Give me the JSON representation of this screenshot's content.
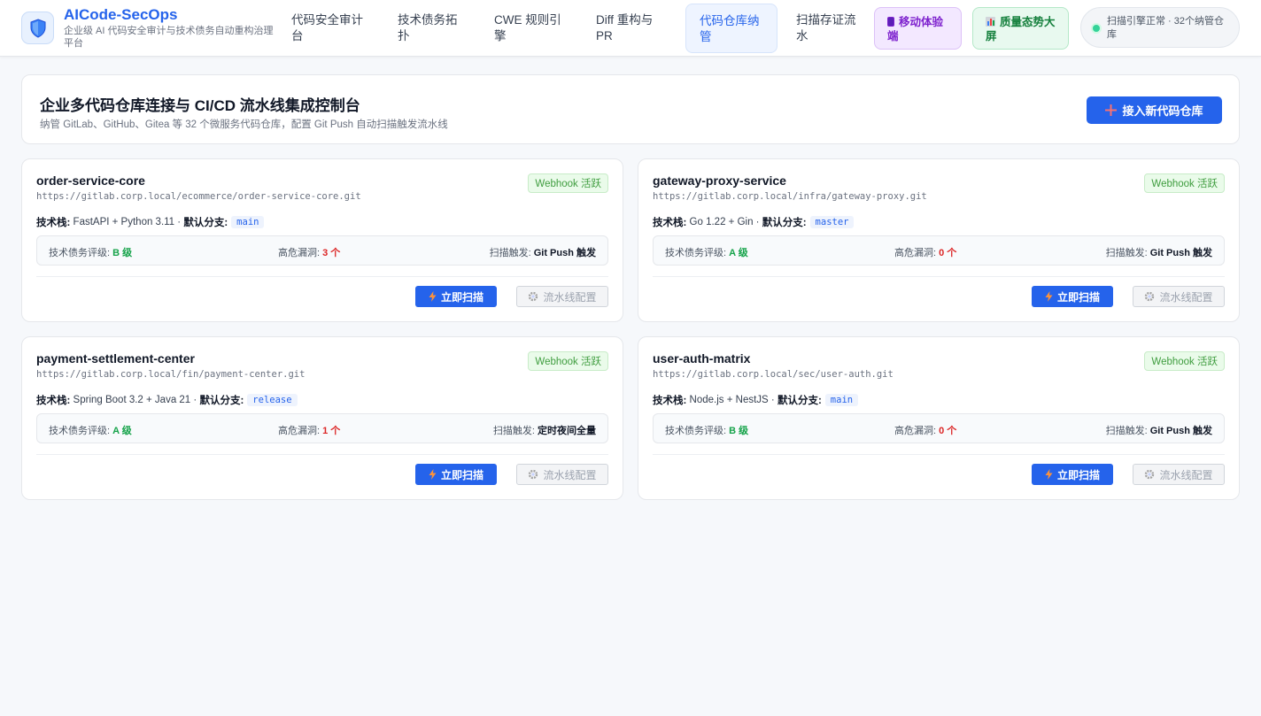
{
  "header": {
    "brand_title": "AICode-SecOps",
    "brand_subtitle": "企业级 AI 代码安全审计与技术债务自动重构治理平台",
    "logo_icon": "shield-icon",
    "nav": [
      {
        "label": "代码安全审计台",
        "active": false
      },
      {
        "label": "技术债务拓扑",
        "active": false
      },
      {
        "label": "CWE 规则引擎",
        "active": false
      },
      {
        "label": "Diff 重构与 PR",
        "active": false
      },
      {
        "label": "代码仓库纳管",
        "active": true
      },
      {
        "label": "扫描存证流水",
        "active": false
      }
    ],
    "mobile_button": {
      "icon": "mobile-icon",
      "label": "移动体验端"
    },
    "dashboard_button": {
      "icon": "bar-chart-icon",
      "label": "质量态势大屏"
    },
    "status_text": "扫描引擎正常 · 32个纳管仓库",
    "status_color": "#34d399"
  },
  "hero": {
    "title": "企业多代码仓库连接与 CI/CD 流水线集成控制台",
    "subtitle": "纳管 GitLab、GitHub、Gitea 等 32 个微服务代码仓库，配置 Git Push 自动扫描触发流水线",
    "add_repo_label": "接入新代码仓库",
    "add_repo_icon": "plus-icon"
  },
  "labels": {
    "stack_prefix": "技术栈:",
    "branch_prefix": "默认分支:",
    "debt_grade": "技术债务评级:",
    "high_vulns": "高危漏洞:",
    "scan_trigger": "扫描触发:",
    "scan_now": "立即扫描",
    "pipeline_config": "流水线配置"
  },
  "repos": [
    {
      "name": "order-service-core",
      "url": "https://gitlab.corp.local/ecommerce/order-service-core.git",
      "webhook": "Webhook 活跃",
      "stack": "FastAPI + Python 3.11",
      "branch": "main",
      "grade": "B 级",
      "vulns": "3 个",
      "trigger": "Git Push 触发"
    },
    {
      "name": "gateway-proxy-service",
      "url": "https://gitlab.corp.local/infra/gateway-proxy.git",
      "webhook": "Webhook 活跃",
      "stack": "Go 1.22 + Gin",
      "branch": "master",
      "grade": "A 级",
      "vulns": "0 个",
      "trigger": "Git Push 触发"
    },
    {
      "name": "payment-settlement-center",
      "url": "https://gitlab.corp.local/fin/payment-center.git",
      "webhook": "Webhook 活跃",
      "stack": "Spring Boot 3.2 + Java 21",
      "branch": "release",
      "grade": "A 级",
      "vulns": "1 个",
      "trigger": "定时夜间全量"
    },
    {
      "name": "user-auth-matrix",
      "url": "https://gitlab.corp.local/sec/user-auth.git",
      "webhook": "Webhook 活跃",
      "stack": "Node.js + NestJS",
      "branch": "main",
      "grade": "B 级",
      "vulns": "0 个",
      "trigger": "Git Push 触发"
    }
  ]
}
